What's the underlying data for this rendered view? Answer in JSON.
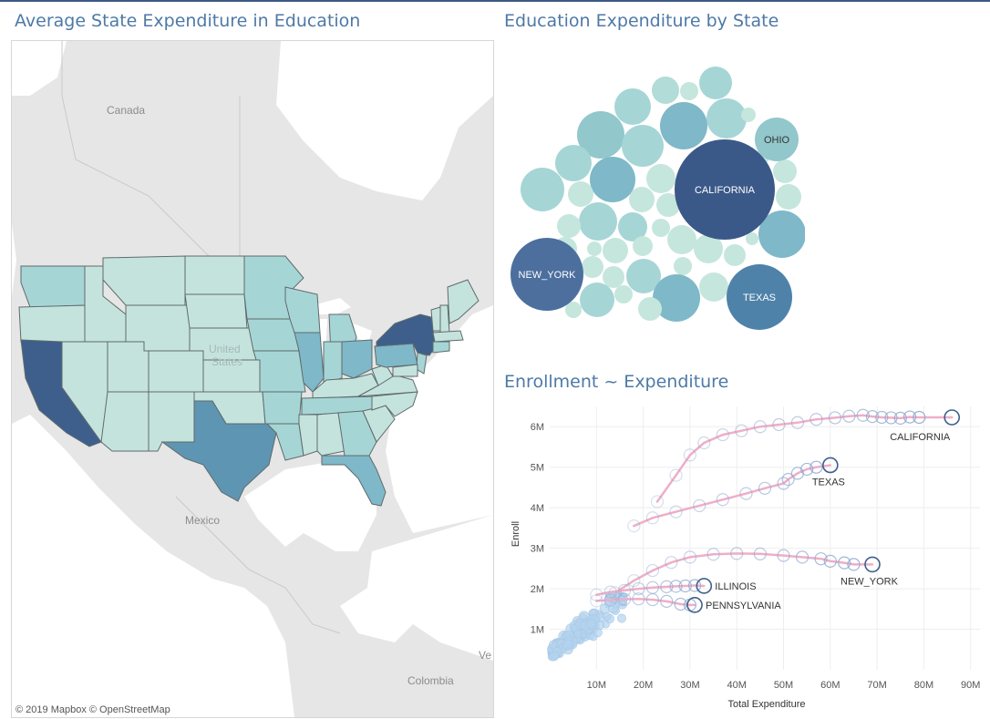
{
  "map_panel": {
    "title": "Average State Expenditure in Education",
    "labels": {
      "canada": "Canada",
      "united_states_1": "United",
      "united_states_2": "States",
      "mexico": "Mexico",
      "colombia": "Colombia",
      "ve": "Ve"
    },
    "credit": "© 2019 Mapbox © OpenStreetMap",
    "colors": {
      "water": "#ffffff",
      "land": "#e6e6e6",
      "light": "#c5e3dd",
      "mid": "#a6d5d6",
      "teal": "#7fb8c8",
      "texas": "#5e95b2",
      "dark": "#3e5f8c"
    }
  },
  "bubble_panel": {
    "title": "Education Expenditure by State",
    "labeled_bubbles": [
      {
        "label": "CALIFORNIA",
        "color": "#3b5988"
      },
      {
        "label": "NEW_YORK",
        "color": "#4c6f9e"
      },
      {
        "label": "TEXAS",
        "color": "#4f82a9"
      },
      {
        "label": "OHIO",
        "color": "#92c7cc"
      }
    ]
  },
  "chart_data": {
    "type": "scatter",
    "title": "Enrollment ~ Expenditure",
    "xlabel": "Total Expenditure",
    "ylabel": "Enroll",
    "x_ticks": [
      "10M",
      "20M",
      "30M",
      "40M",
      "50M",
      "60M",
      "70M",
      "80M",
      "90M"
    ],
    "y_ticks": [
      "1M",
      "2M",
      "3M",
      "4M",
      "5M",
      "6M"
    ],
    "xlim": [
      0,
      92000000
    ],
    "ylim": [
      0,
      6500000
    ],
    "grid": true,
    "colors": {
      "trend": "#efaec7",
      "point": "#8ea8cf",
      "point_dark": "#3e5f8c",
      "cluster": "#b3d3ee"
    },
    "series": [
      {
        "label": "CALIFORNIA",
        "x": [
          23000000,
          27000000,
          30000000,
          33000000,
          37000000,
          41000000,
          45000000,
          49000000,
          53000000,
          57000000,
          61000000,
          64000000,
          67000000,
          69000000,
          71000000,
          73000000,
          75000000,
          77000000,
          79000000,
          86000000
        ],
        "y": [
          4150000,
          4800000,
          5300000,
          5600000,
          5800000,
          5900000,
          6000000,
          6050000,
          6100000,
          6180000,
          6220000,
          6260000,
          6280000,
          6250000,
          6230000,
          6220000,
          6210000,
          6240000,
          6230000,
          6230000
        ]
      },
      {
        "label": "TEXAS",
        "x": [
          18000000,
          22000000,
          27000000,
          32000000,
          37000000,
          42000000,
          46000000,
          50000000,
          51000000,
          53000000,
          55000000,
          57000000,
          60000000
        ],
        "y": [
          3550000,
          3750000,
          3900000,
          4050000,
          4200000,
          4350000,
          4480000,
          4600000,
          4700000,
          4850000,
          4950000,
          5000000,
          5050000
        ]
      },
      {
        "label": "NEW_YORK",
        "x": [
          14000000,
          18000000,
          22000000,
          26000000,
          30000000,
          35000000,
          40000000,
          45000000,
          50000000,
          54000000,
          58000000,
          60000000,
          63000000,
          65000000,
          69000000
        ],
        "y": [
          1900000,
          2200000,
          2450000,
          2650000,
          2780000,
          2850000,
          2870000,
          2860000,
          2820000,
          2780000,
          2740000,
          2680000,
          2640000,
          2600000,
          2600000
        ]
      },
      {
        "label": "ILLINOIS",
        "x": [
          10000000,
          13000000,
          16000000,
          19000000,
          22000000,
          25000000,
          27000000,
          29000000,
          31000000,
          33000000
        ],
        "y": [
          1850000,
          1920000,
          1960000,
          2000000,
          2030000,
          2050000,
          2060000,
          2070000,
          2080000,
          2070000
        ]
      },
      {
        "label": "PENNSYLVANIA",
        "x": [
          10000000,
          13000000,
          16000000,
          19000000,
          22000000,
          25000000,
          28000000,
          30000000,
          31000000
        ],
        "y": [
          1700000,
          1720000,
          1740000,
          1750000,
          1730000,
          1690000,
          1620000,
          1600000,
          1600000
        ]
      }
    ]
  }
}
